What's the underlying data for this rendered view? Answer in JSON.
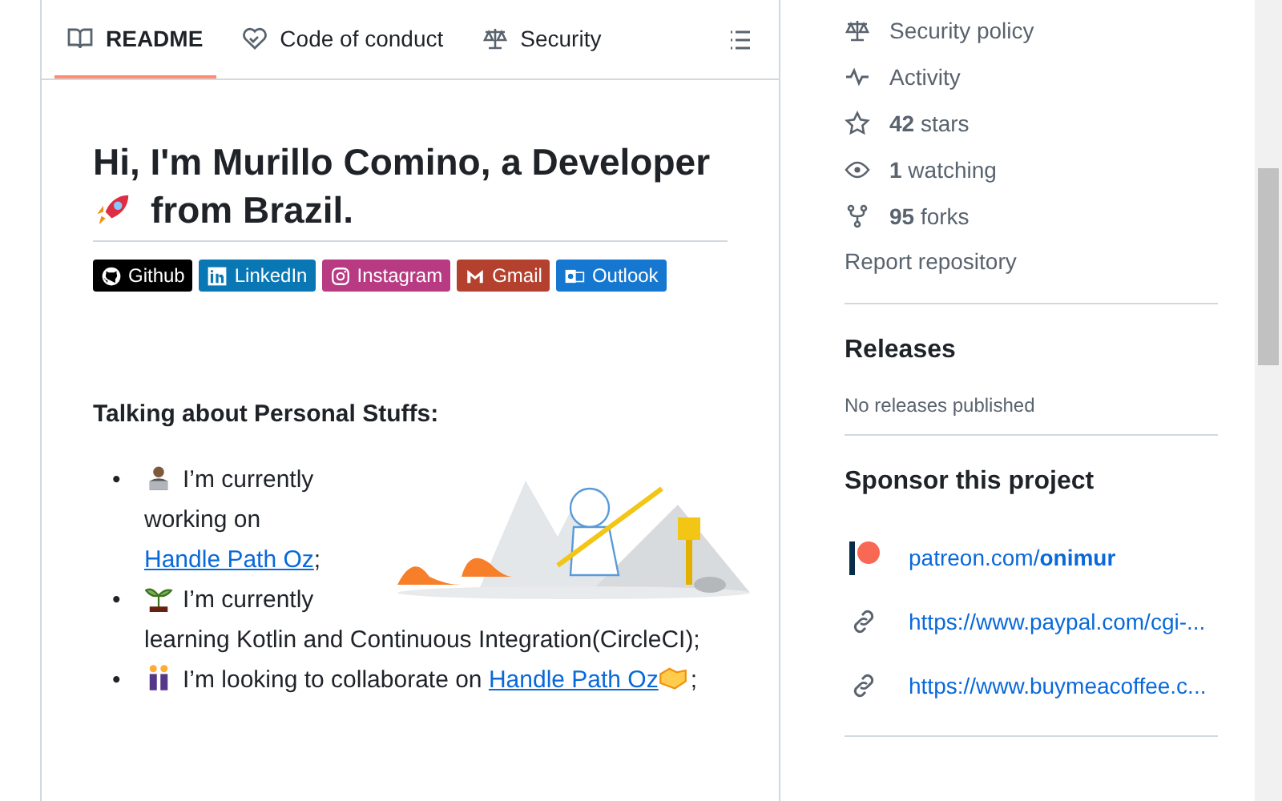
{
  "tabs": [
    {
      "label": "README",
      "selected": true
    },
    {
      "label": "Code of conduct",
      "selected": false
    },
    {
      "label": "Security",
      "selected": false
    }
  ],
  "readme": {
    "heading": "Hi, I'm Murillo Comino, a Developer",
    "heading_tail": "from Brazil.",
    "badges": [
      {
        "label": "Github",
        "color": "#000000"
      },
      {
        "label": "LinkedIn",
        "color": "#0a77b5"
      },
      {
        "label": "Instagram",
        "color": "#b83a82"
      },
      {
        "label": "Gmail",
        "color": "#b4412e"
      },
      {
        "label": "Outlook",
        "color": "#1577cf"
      }
    ],
    "section_title": "Talking about Personal Stuffs:",
    "items": [
      {
        "marker": "•",
        "parts": [
          {
            "kind": "text",
            "text": "I’m currently working on "
          },
          {
            "kind": "link",
            "text": "Handle Path Oz"
          },
          {
            "kind": "text",
            "text": ";"
          }
        ]
      },
      {
        "marker": "•",
        "parts": [
          {
            "kind": "text",
            "text": "I’m currently learning Kotlin and Continuous Integration(CircleCI);"
          }
        ]
      },
      {
        "marker": "•",
        "parts": [
          {
            "kind": "text",
            "text": "I’m looking to collaborate on "
          },
          {
            "kind": "link",
            "text": "Handle Path Oz"
          },
          {
            "kind": "icon"
          },
          {
            "kind": "text",
            "text": ";"
          }
        ]
      }
    ]
  },
  "about": [
    {
      "text": "Security policy"
    },
    {
      "text": "Activity"
    },
    {
      "text": "**42** stars"
    },
    {
      "text": "**1** watching"
    },
    {
      "text": "**95** forks"
    }
  ],
  "report": "Report repository",
  "releases": {
    "title": "Releases",
    "empty": "No releases published"
  },
  "sponsor": {
    "title": "Sponsor this project",
    "links": [
      {
        "text": "patreon.com/**onimur**"
      },
      {
        "text": "https://www.paypal.com/cgi-..."
      },
      {
        "text": "https://www.buymeacoffee.c..."
      }
    ]
  }
}
